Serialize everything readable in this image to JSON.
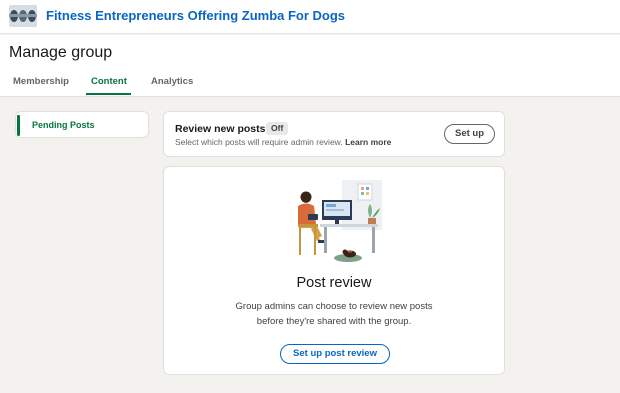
{
  "group": {
    "name": "Fitness Entrepreneurs Offering Zumba For Dogs",
    "logo_icon": "group-logo-icon"
  },
  "header": {
    "title": "Manage group",
    "tabs": [
      {
        "label": "Membership",
        "active": false
      },
      {
        "label": "Content",
        "active": true
      },
      {
        "label": "Analytics",
        "active": false
      }
    ]
  },
  "sidebar": {
    "items": [
      {
        "label": "Pending Posts",
        "active": true
      }
    ]
  },
  "review_settings": {
    "title": "Review new posts",
    "status": "Off",
    "description": "Select which posts will require admin review.",
    "learn_more": "Learn more",
    "setup_label": "Set up"
  },
  "post_review": {
    "illustration": "person-at-desk-illustration",
    "heading": "Post review",
    "body": "Group admins can choose to review new posts before they're shared with the group.",
    "cta_label": "Set up post review"
  },
  "colors": {
    "brand_blue": "#0a66c2",
    "accent_green": "#057642",
    "background": "#f4f2ee"
  }
}
